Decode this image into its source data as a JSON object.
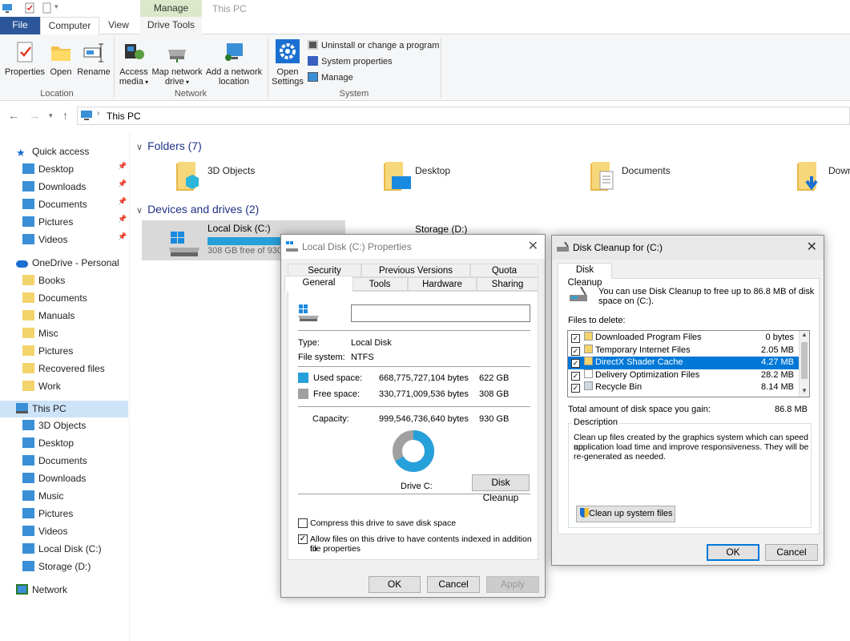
{
  "window": {
    "title": "This PC",
    "manage_tab": "Manage"
  },
  "ribbon_tabs": [
    "File",
    "Computer",
    "View",
    "Drive Tools"
  ],
  "ribbon": {
    "location": {
      "label": "Location",
      "properties": "Properties",
      "open": "Open",
      "rename": "Rename"
    },
    "network": {
      "label": "Network",
      "access_media_1": "Access",
      "access_media_2": "media",
      "map_drive_1": "Map network",
      "map_drive_2": "drive",
      "add_location_1": "Add a network",
      "add_location_2": "location"
    },
    "system": {
      "label": "System",
      "open_settings_1": "Open",
      "open_settings_2": "Settings",
      "uninstall": "Uninstall or change a program",
      "sys_props": "System properties",
      "manage": "Manage"
    }
  },
  "address": {
    "path": "This PC"
  },
  "nav": {
    "quick_access": "Quick access",
    "quick_items": [
      "Desktop",
      "Downloads",
      "Documents",
      "Pictures",
      "Videos"
    ],
    "onedrive": "OneDrive - Personal",
    "onedrive_items": [
      "Books",
      "Documents",
      "Manuals",
      "Misc",
      "Pictures",
      "Recovered files",
      "Work"
    ],
    "this_pc": "This PC",
    "pc_items": [
      "3D Objects",
      "Desktop",
      "Documents",
      "Downloads",
      "Music",
      "Pictures",
      "Videos",
      "Local Disk (C:)",
      "Storage (D:)"
    ],
    "network": "Network"
  },
  "content": {
    "folders_header": "Folders (7)",
    "folders": [
      "3D Objects",
      "Desktop",
      "Documents",
      "Downl"
    ],
    "devices_header": "Devices and drives (2)",
    "drive_c": {
      "name": "Local Disk (C:)",
      "free": "308 GB free of 930 G",
      "used_fraction": 0.67
    },
    "drive_d": {
      "name": "Storage (D:)"
    }
  },
  "props": {
    "title": "Local Disk (C:) Properties",
    "tabs_top": [
      "Security",
      "Previous Versions",
      "Quota"
    ],
    "tabs_bottom": [
      "General",
      "Tools",
      "Hardware",
      "Sharing"
    ],
    "name_value": "",
    "type_label": "Type:",
    "type_value": "Local Disk",
    "fs_label": "File system:",
    "fs_value": "NTFS",
    "used_label": "Used space:",
    "used_bytes": "668,775,727,104 bytes",
    "used_gb": "622 GB",
    "free_label": "Free space:",
    "free_bytes": "330,771,009,536 bytes",
    "free_gb": "308 GB",
    "cap_label": "Capacity:",
    "cap_bytes": "999,546,736,640 bytes",
    "cap_gb": "930 GB",
    "used_fraction": 0.669,
    "drive_label": "Drive C:",
    "disk_cleanup": "Disk Cleanup",
    "compress": "Compress this drive to save disk space",
    "index_1": "Allow files on this drive to have contents indexed in addition to",
    "index_2": "file properties",
    "ok": "OK",
    "cancel": "Cancel",
    "apply": "Apply",
    "colors": {
      "used": "#26a0da",
      "free": "#a0a0a0"
    }
  },
  "cleanup": {
    "title": "Disk Cleanup for  (C:)",
    "tab": "Disk Cleanup",
    "intro_1": "You can use Disk Cleanup to free up to 86.8 MB of disk",
    "intro_2": "space on  (C:).",
    "files_label": "Files to delete:",
    "files": [
      {
        "name": "Downloaded Program Files",
        "size": "0 bytes",
        "checked": true
      },
      {
        "name": "Temporary Internet Files",
        "size": "2.05 MB",
        "checked": true
      },
      {
        "name": "DirectX Shader Cache",
        "size": "4.27 MB",
        "checked": true
      },
      {
        "name": "Delivery Optimization Files",
        "size": "28.2 MB",
        "checked": true
      },
      {
        "name": "Recycle Bin",
        "size": "8.14 MB",
        "checked": true
      }
    ],
    "selected_index": 2,
    "total_label": "Total amount of disk space you gain:",
    "total_value": "86.8 MB",
    "description_label": "Description",
    "desc_1": "Clean up files created by the graphics system which can speed up",
    "desc_2": "application load time and improve responsiveness. They will be",
    "desc_3": "re-generated as needed.",
    "cleanup_system": "Clean up system files",
    "ok": "OK",
    "cancel": "Cancel"
  }
}
